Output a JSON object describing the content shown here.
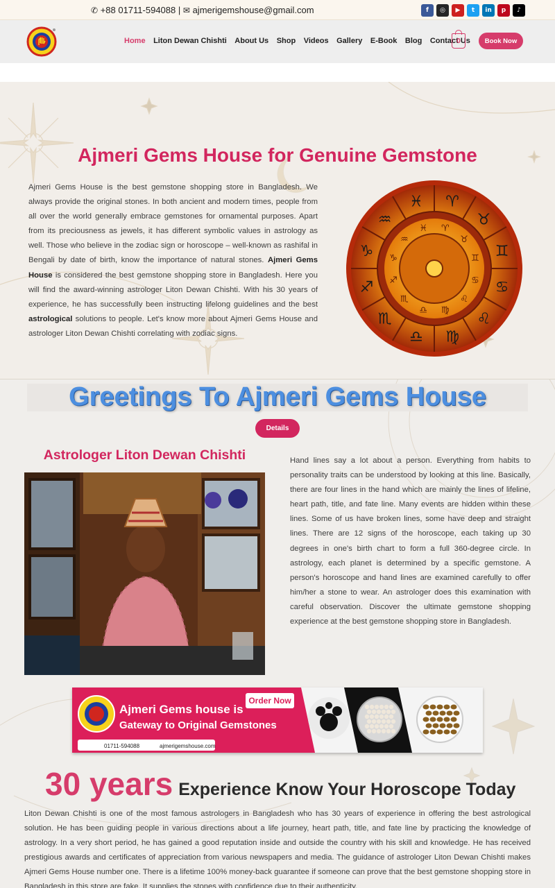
{
  "topbar": {
    "phone": "+88 01711-594088",
    "separator": "|",
    "email": "ajmerigemshouse@gmail.com",
    "socials": [
      {
        "name": "facebook-icon",
        "glyph": "f",
        "color": "#3b5998"
      },
      {
        "name": "instagram-icon",
        "glyph": "◎",
        "color": "#262626"
      },
      {
        "name": "youtube-icon",
        "glyph": "▶",
        "color": "#cd201f"
      },
      {
        "name": "twitter-icon",
        "glyph": "t",
        "color": "#1da1f2"
      },
      {
        "name": "linkedin-icon",
        "glyph": "in",
        "color": "#0077b5"
      },
      {
        "name": "pinterest-icon",
        "glyph": "p",
        "color": "#bd081c"
      },
      {
        "name": "tiktok-icon",
        "glyph": "♪",
        "color": "#000000"
      }
    ]
  },
  "nav": {
    "items": [
      "Home",
      "Liton Dewan Chishti",
      "About Us",
      "Shop",
      "Videos",
      "Gallery",
      "E-Book",
      "Blog",
      "Contact Us"
    ],
    "cart_count": "0",
    "book_label": "Book Now"
  },
  "hero": {
    "title": "Ajmeri Gems House for Genuine Gemstone",
    "para_1": "Ajmeri Gems House is the best gemstone shopping store in Bangladesh. We always provide the original stones. In both ancient and modern times, people from all over the world generally embrace gemstones for ornamental purposes. Apart from its preciousness as jewels, it has different symbolic values in astrology as well. Those who believe in the zodiac sign or horoscope – well-known as rashifal in Bengali by date of birth, know the importance of natural stones.",
    "bold_1": "Ajmeri Gems House",
    "para_2": "is considered the best gemstone shopping store in Bangladesh. Here you will find the award-winning astrologer Liton Dewan Chishti. With his 30 years of experience, he has successfully been instructing lifelong guidelines and the best",
    "bold_2": "astrological",
    "para_3": "solutions to people. Let's know more about Ajmeri Gems House and astrologer Liton Dewan Chishti correlating with zodiac signs."
  },
  "greeting": {
    "title": "Greetings To Ajmeri Gems House",
    "details_label": "Details"
  },
  "astrologer": {
    "title": "Astrologer Liton Dewan Chishti",
    "para": "Hand lines say a lot about a person. Everything from habits to personality traits can be understood by looking at this line. Basically, there are four lines in the hand which are mainly the lines of lifeline, heart path, title, and fate line. Many events are hidden within these lines. Some of us have broken lines, some have deep and straight lines. There are 12 signs of the horoscope, each taking up 30 degrees in one's birth chart to form a full 360-degree circle. In astrology, each planet is determined by a specific gemstone. A person's horoscope and hand lines are examined carefully to offer him/her a stone to wear. An astrologer does this examination with careful observation. Discover the ultimate gemstone shopping experience at the best gemstone shopping store in Bangladesh."
  },
  "banner": {
    "order_label": "Order Now",
    "line1": "Ajmeri Gems house is",
    "line2": "Gateway to Original Gemstones",
    "phone": "01711-594088",
    "website": "ajmerigemshouse.com"
  },
  "experience": {
    "years": "30 years",
    "subtitle": "Experience Know Your Horoscope Today",
    "para": "Liton Dewan Chishti is one of the most famous astrologers in Bangladesh who has 30 years of experience in offering the best astrological solution. He has been guiding people in various directions about a life journey, heart path, title, and fate line by practicing the knowledge of astrology. In a very short period, he has gained a good reputation inside and outside the country with his skill and knowledge. He has received prestigious awards and certificates of appreciation from various newspapers and media. The guidance of astrologer Liton Dewan Chishti makes Ajmeri Gems House number one. There is a lifetime 100% money-back guarantee if someone can prove that the best gemstone shopping store in Bangladesh in this store are fake. It supplies the stones with confidence due to their authenticity."
  }
}
